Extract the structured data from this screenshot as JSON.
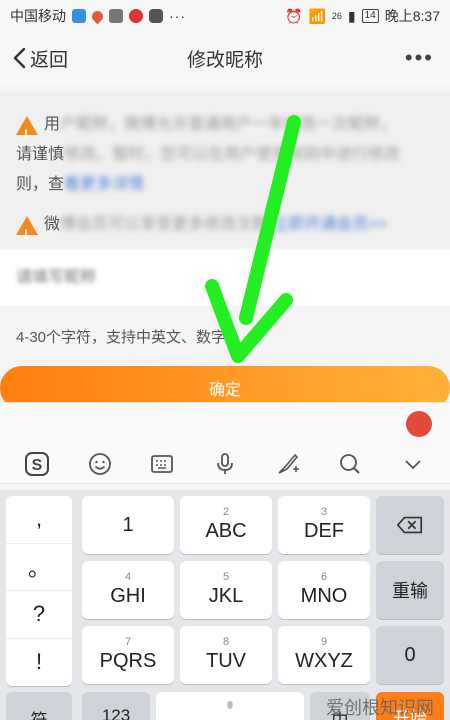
{
  "status_bar": {
    "carrier": "中国移动",
    "network": "26",
    "battery": "14",
    "time": "晚上8:37",
    "dots": "···"
  },
  "nav": {
    "back_label": "返回",
    "title": "修改昵称",
    "more": "•••"
  },
  "notice": {
    "line1_visible": "用",
    "line1_blur": "户昵称，微博允许普通用户一年修改一次昵称，",
    "line2_visible": "请谨慎",
    "line2_blur": "修改。暂时，您可以在用户使用规则中进行修改",
    "line3_visible": "则，查",
    "line3_blur": "看更多详情",
    "line4_visible": "微",
    "line4_blur": "博会员可以享受更多修改次数",
    "line4_link": "立即开通会员>>"
  },
  "input": {
    "placeholder": "请填写昵称"
  },
  "hint": "4-30个字符，支持中英文、数字",
  "confirm_label": "确定",
  "keyboard": {
    "side": [
      ",",
      "。",
      "?",
      "!"
    ],
    "rows": [
      [
        {
          "sub": "1",
          "main": ""
        },
        {
          "sub": "2",
          "main": "ABC"
        },
        {
          "sub": "3",
          "main": "DEF"
        }
      ],
      [
        {
          "sub": "4",
          "main": "GHI"
        },
        {
          "sub": "5",
          "main": "JKL"
        },
        {
          "sub": "6",
          "main": "MNO"
        }
      ],
      [
        {
          "sub": "7",
          "main": "PQRS"
        },
        {
          "sub": "8",
          "main": "TUV"
        },
        {
          "sub": "9",
          "main": "WXYZ"
        }
      ]
    ],
    "row1_first_main": "1",
    "backspace": "⌫",
    "retype": "重输",
    "zero": "0",
    "symbol": "符",
    "num": "123",
    "cn": "中",
    "start": "开始"
  },
  "watermark": "爱创根知识网",
  "colors": {
    "accent": "#ff8a1a",
    "arrow": "#22ee22"
  }
}
